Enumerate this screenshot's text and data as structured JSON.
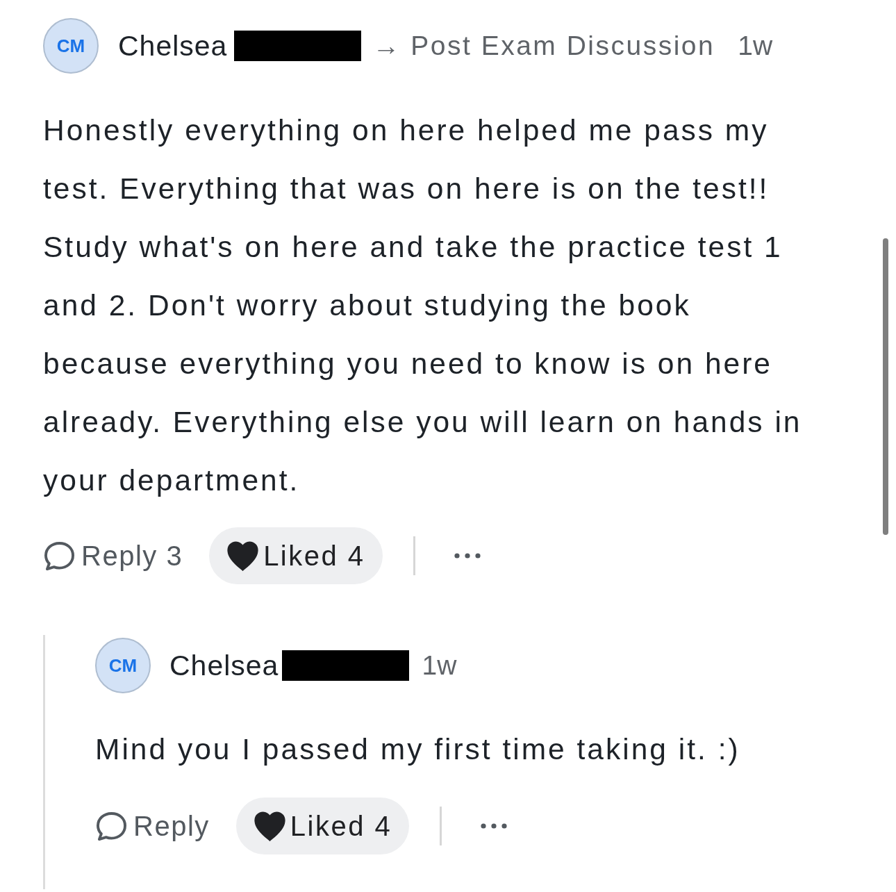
{
  "post": {
    "author": {
      "initials": "CM",
      "name": "Chelsea",
      "redacted": true
    },
    "destination": "→ Post Exam Discussion",
    "time": "1w",
    "body": "Honestly everything on here helped me pass my test. Everything that was on here is on the test!! Study what's on here and take the practice test 1 and 2. Don't worry about studying the book because everything you need to know is on here already. Everything else you will learn on hands in your department.",
    "actions": {
      "reply": "Reply 3",
      "like": {
        "label": "Liked 4",
        "liked": true
      }
    },
    "replies": [
      {
        "author": {
          "initials": "CM",
          "name": "Chelsea",
          "redacted": true
        },
        "time": "1w",
        "body": "Mind you I passed my first time taking it. :)",
        "actions": {
          "reply": "Reply",
          "like": {
            "label": "Liked 4",
            "liked": true
          }
        }
      }
    ]
  }
}
